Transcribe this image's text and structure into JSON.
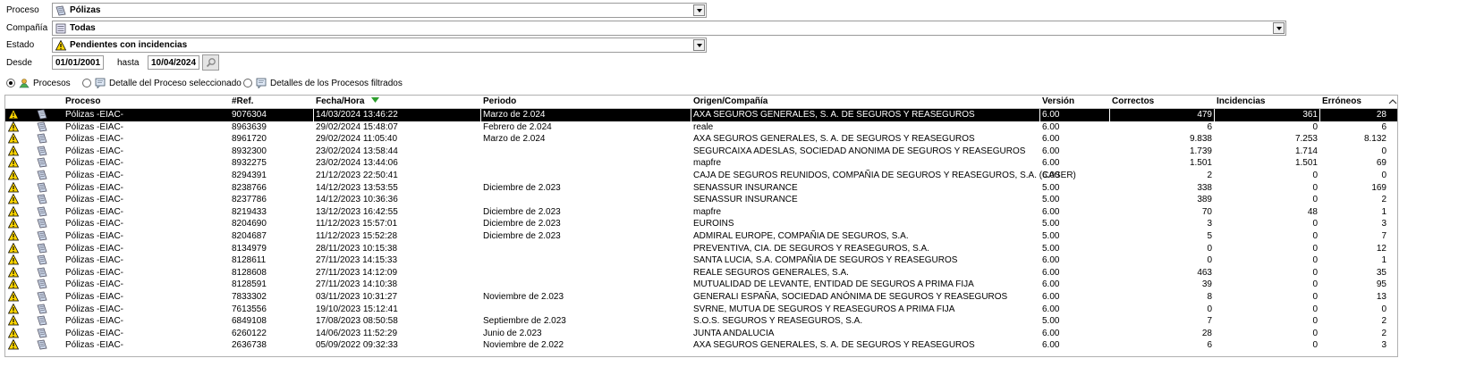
{
  "filters": {
    "proceso_label": "Proceso",
    "proceso_value": "Pólizas",
    "compania_label": "Compañía",
    "compania_value": "Todas",
    "estado_label": "Estado",
    "estado_value": "Pendientes con incidencias",
    "desde_label": "Desde",
    "desde_value": "01/01/2001",
    "hasta_label": "hasta",
    "hasta_value": "10/04/2024"
  },
  "view_options": [
    {
      "label": "Procesos",
      "selected": true
    },
    {
      "label": "Detalle del Proceso seleccionado",
      "selected": false
    },
    {
      "label": "Detalles de los Procesos filtrados",
      "selected": false
    }
  ],
  "columns": [
    "Proceso",
    "#Ref.",
    "Fecha/Hora",
    "Periodo",
    "Origen/Compañía",
    "Versión",
    "Correctos",
    "Incidencias",
    "Erróneos"
  ],
  "colors": {
    "selected_row_bg": "#000000",
    "warning_yellow": "#ffd700",
    "sort_arrow": "#2e9e2e"
  },
  "rows": [
    {
      "proceso": "Pólizas -EIAC-",
      "ref": "9076304",
      "fecha": "14/03/2024 13:46:22",
      "periodo": "Marzo de 2.024",
      "origen": "AXA SEGUROS GENERALES, S. A. DE SEGUROS Y REASEGUROS",
      "version": "6.00",
      "correctos": "479",
      "incidencias": "361",
      "erroneos": "28",
      "selected": true
    },
    {
      "proceso": "Pólizas -EIAC-",
      "ref": "8963639",
      "fecha": "29/02/2024 15:48:07",
      "periodo": "Febrero de 2.024",
      "origen": "reale",
      "version": "6.00",
      "correctos": "6",
      "incidencias": "0",
      "erroneos": "6"
    },
    {
      "proceso": "Pólizas -EIAC-",
      "ref": "8961720",
      "fecha": "29/02/2024 11:05:40",
      "periodo": "Marzo de 2.024",
      "origen": "AXA SEGUROS GENERALES, S. A. DE SEGUROS Y REASEGUROS",
      "version": "6.00",
      "correctos": "9.838",
      "incidencias": "7.253",
      "erroneos": "8.132"
    },
    {
      "proceso": "Pólizas -EIAC-",
      "ref": "8932300",
      "fecha": "23/02/2024 13:58:44",
      "periodo": "",
      "origen": "SEGURCAIXA ADESLAS, SOCIEDAD ANONIMA DE SEGUROS Y REASEGUROS",
      "version": "6.00",
      "correctos": "1.739",
      "incidencias": "1.714",
      "erroneos": "0"
    },
    {
      "proceso": "Pólizas -EIAC-",
      "ref": "8932275",
      "fecha": "23/02/2024 13:44:06",
      "periodo": "",
      "origen": "mapfre",
      "version": "6.00",
      "correctos": "1.501",
      "incidencias": "1.501",
      "erroneos": "69"
    },
    {
      "proceso": "Pólizas -EIAC-",
      "ref": "8294391",
      "fecha": "21/12/2023 22:50:41",
      "periodo": "",
      "origen": "CAJA DE SEGUROS REUNIDOS, COMPAÑIA DE SEGUROS Y REASEGUROS, S.A. (CASER)",
      "version": "6.00",
      "correctos": "2",
      "incidencias": "0",
      "erroneos": "0"
    },
    {
      "proceso": "Pólizas -EIAC-",
      "ref": "8238766",
      "fecha": "14/12/2023 13:53:55",
      "periodo": "Diciembre de 2.023",
      "origen": "SENASSUR INSURANCE",
      "version": "5.00",
      "correctos": "338",
      "incidencias": "0",
      "erroneos": "169"
    },
    {
      "proceso": "Pólizas -EIAC-",
      "ref": "8237786",
      "fecha": "14/12/2023 10:36:36",
      "periodo": "",
      "origen": "SENASSUR INSURANCE",
      "version": "5.00",
      "correctos": "389",
      "incidencias": "0",
      "erroneos": "2"
    },
    {
      "proceso": "Pólizas -EIAC-",
      "ref": "8219433",
      "fecha": "13/12/2023 16:42:55",
      "periodo": "Diciembre de 2.023",
      "origen": "mapfre",
      "version": "6.00",
      "correctos": "70",
      "incidencias": "48",
      "erroneos": "1"
    },
    {
      "proceso": "Pólizas -EIAC-",
      "ref": "8204690",
      "fecha": "11/12/2023 15:57:01",
      "periodo": "Diciembre de 2.023",
      "origen": "EUROINS",
      "version": "5.00",
      "correctos": "3",
      "incidencias": "0",
      "erroneos": "3"
    },
    {
      "proceso": "Pólizas -EIAC-",
      "ref": "8204687",
      "fecha": "11/12/2023 15:52:28",
      "periodo": "Diciembre de 2.023",
      "origen": "ADMIRAL EUROPE, COMPAÑIA DE SEGUROS, S.A.",
      "version": "5.00",
      "correctos": "5",
      "incidencias": "0",
      "erroneos": "7"
    },
    {
      "proceso": "Pólizas -EIAC-",
      "ref": "8134979",
      "fecha": "28/11/2023 10:15:38",
      "periodo": "",
      "origen": "PREVENTIVA, CIA. DE SEGUROS Y REASEGUROS, S.A.",
      "version": "5.00",
      "correctos": "0",
      "incidencias": "0",
      "erroneos": "12"
    },
    {
      "proceso": "Pólizas -EIAC-",
      "ref": "8128611",
      "fecha": "27/11/2023 14:15:33",
      "periodo": "",
      "origen": "SANTA LUCIA, S.A. COMPAÑIA DE SEGUROS Y REASEGUROS",
      "version": "6.00",
      "correctos": "0",
      "incidencias": "0",
      "erroneos": "1"
    },
    {
      "proceso": "Pólizas -EIAC-",
      "ref": "8128608",
      "fecha": "27/11/2023 14:12:09",
      "periodo": "",
      "origen": "REALE SEGUROS GENERALES, S.A.",
      "version": "6.00",
      "correctos": "463",
      "incidencias": "0",
      "erroneos": "35"
    },
    {
      "proceso": "Pólizas -EIAC-",
      "ref": "8128591",
      "fecha": "27/11/2023 14:10:38",
      "periodo": "",
      "origen": "MUTUALIDAD DE LEVANTE, ENTIDAD DE SEGUROS A PRIMA FIJA",
      "version": "6.00",
      "correctos": "39",
      "incidencias": "0",
      "erroneos": "95"
    },
    {
      "proceso": "Pólizas -EIAC-",
      "ref": "7833302",
      "fecha": "03/11/2023 10:31:27",
      "periodo": "Noviembre de 2.023",
      "origen": "GENERALI ESPAÑA, SOCIEDAD ANÓNIMA DE SEGUROS Y REASEGUROS",
      "version": "6.00",
      "correctos": "8",
      "incidencias": "0",
      "erroneos": "13"
    },
    {
      "proceso": "Pólizas -EIAC-",
      "ref": "7613556",
      "fecha": "19/10/2023 15:12:41",
      "periodo": "",
      "origen": "SVRNE, MUTUA DE SEGUROS Y REASEGUROS A PRIMA FIJA",
      "version": "6.00",
      "correctos": "0",
      "incidencias": "0",
      "erroneos": "0"
    },
    {
      "proceso": "Pólizas -EIAC-",
      "ref": "6849108",
      "fecha": "17/08/2023 08:50:58",
      "periodo": "Septiembre de 2.023",
      "origen": "S.O.S. SEGUROS Y REASEGUROS, S.A.",
      "version": "5.00",
      "correctos": "7",
      "incidencias": "0",
      "erroneos": "2"
    },
    {
      "proceso": "Pólizas -EIAC-",
      "ref": "6260122",
      "fecha": "14/06/2023 11:52:29",
      "periodo": "Junio de 2.023",
      "origen": "JUNTA ANDALUCIA",
      "version": "6.00",
      "correctos": "28",
      "incidencias": "0",
      "erroneos": "2"
    },
    {
      "proceso": "Pólizas -EIAC-",
      "ref": "2636738",
      "fecha": "05/09/2022 09:32:33",
      "periodo": "Noviembre de 2.022",
      "origen": "AXA SEGUROS GENERALES, S. A. DE SEGUROS Y REASEGUROS",
      "version": "6.00",
      "correctos": "6",
      "incidencias": "0",
      "erroneos": "3"
    }
  ]
}
